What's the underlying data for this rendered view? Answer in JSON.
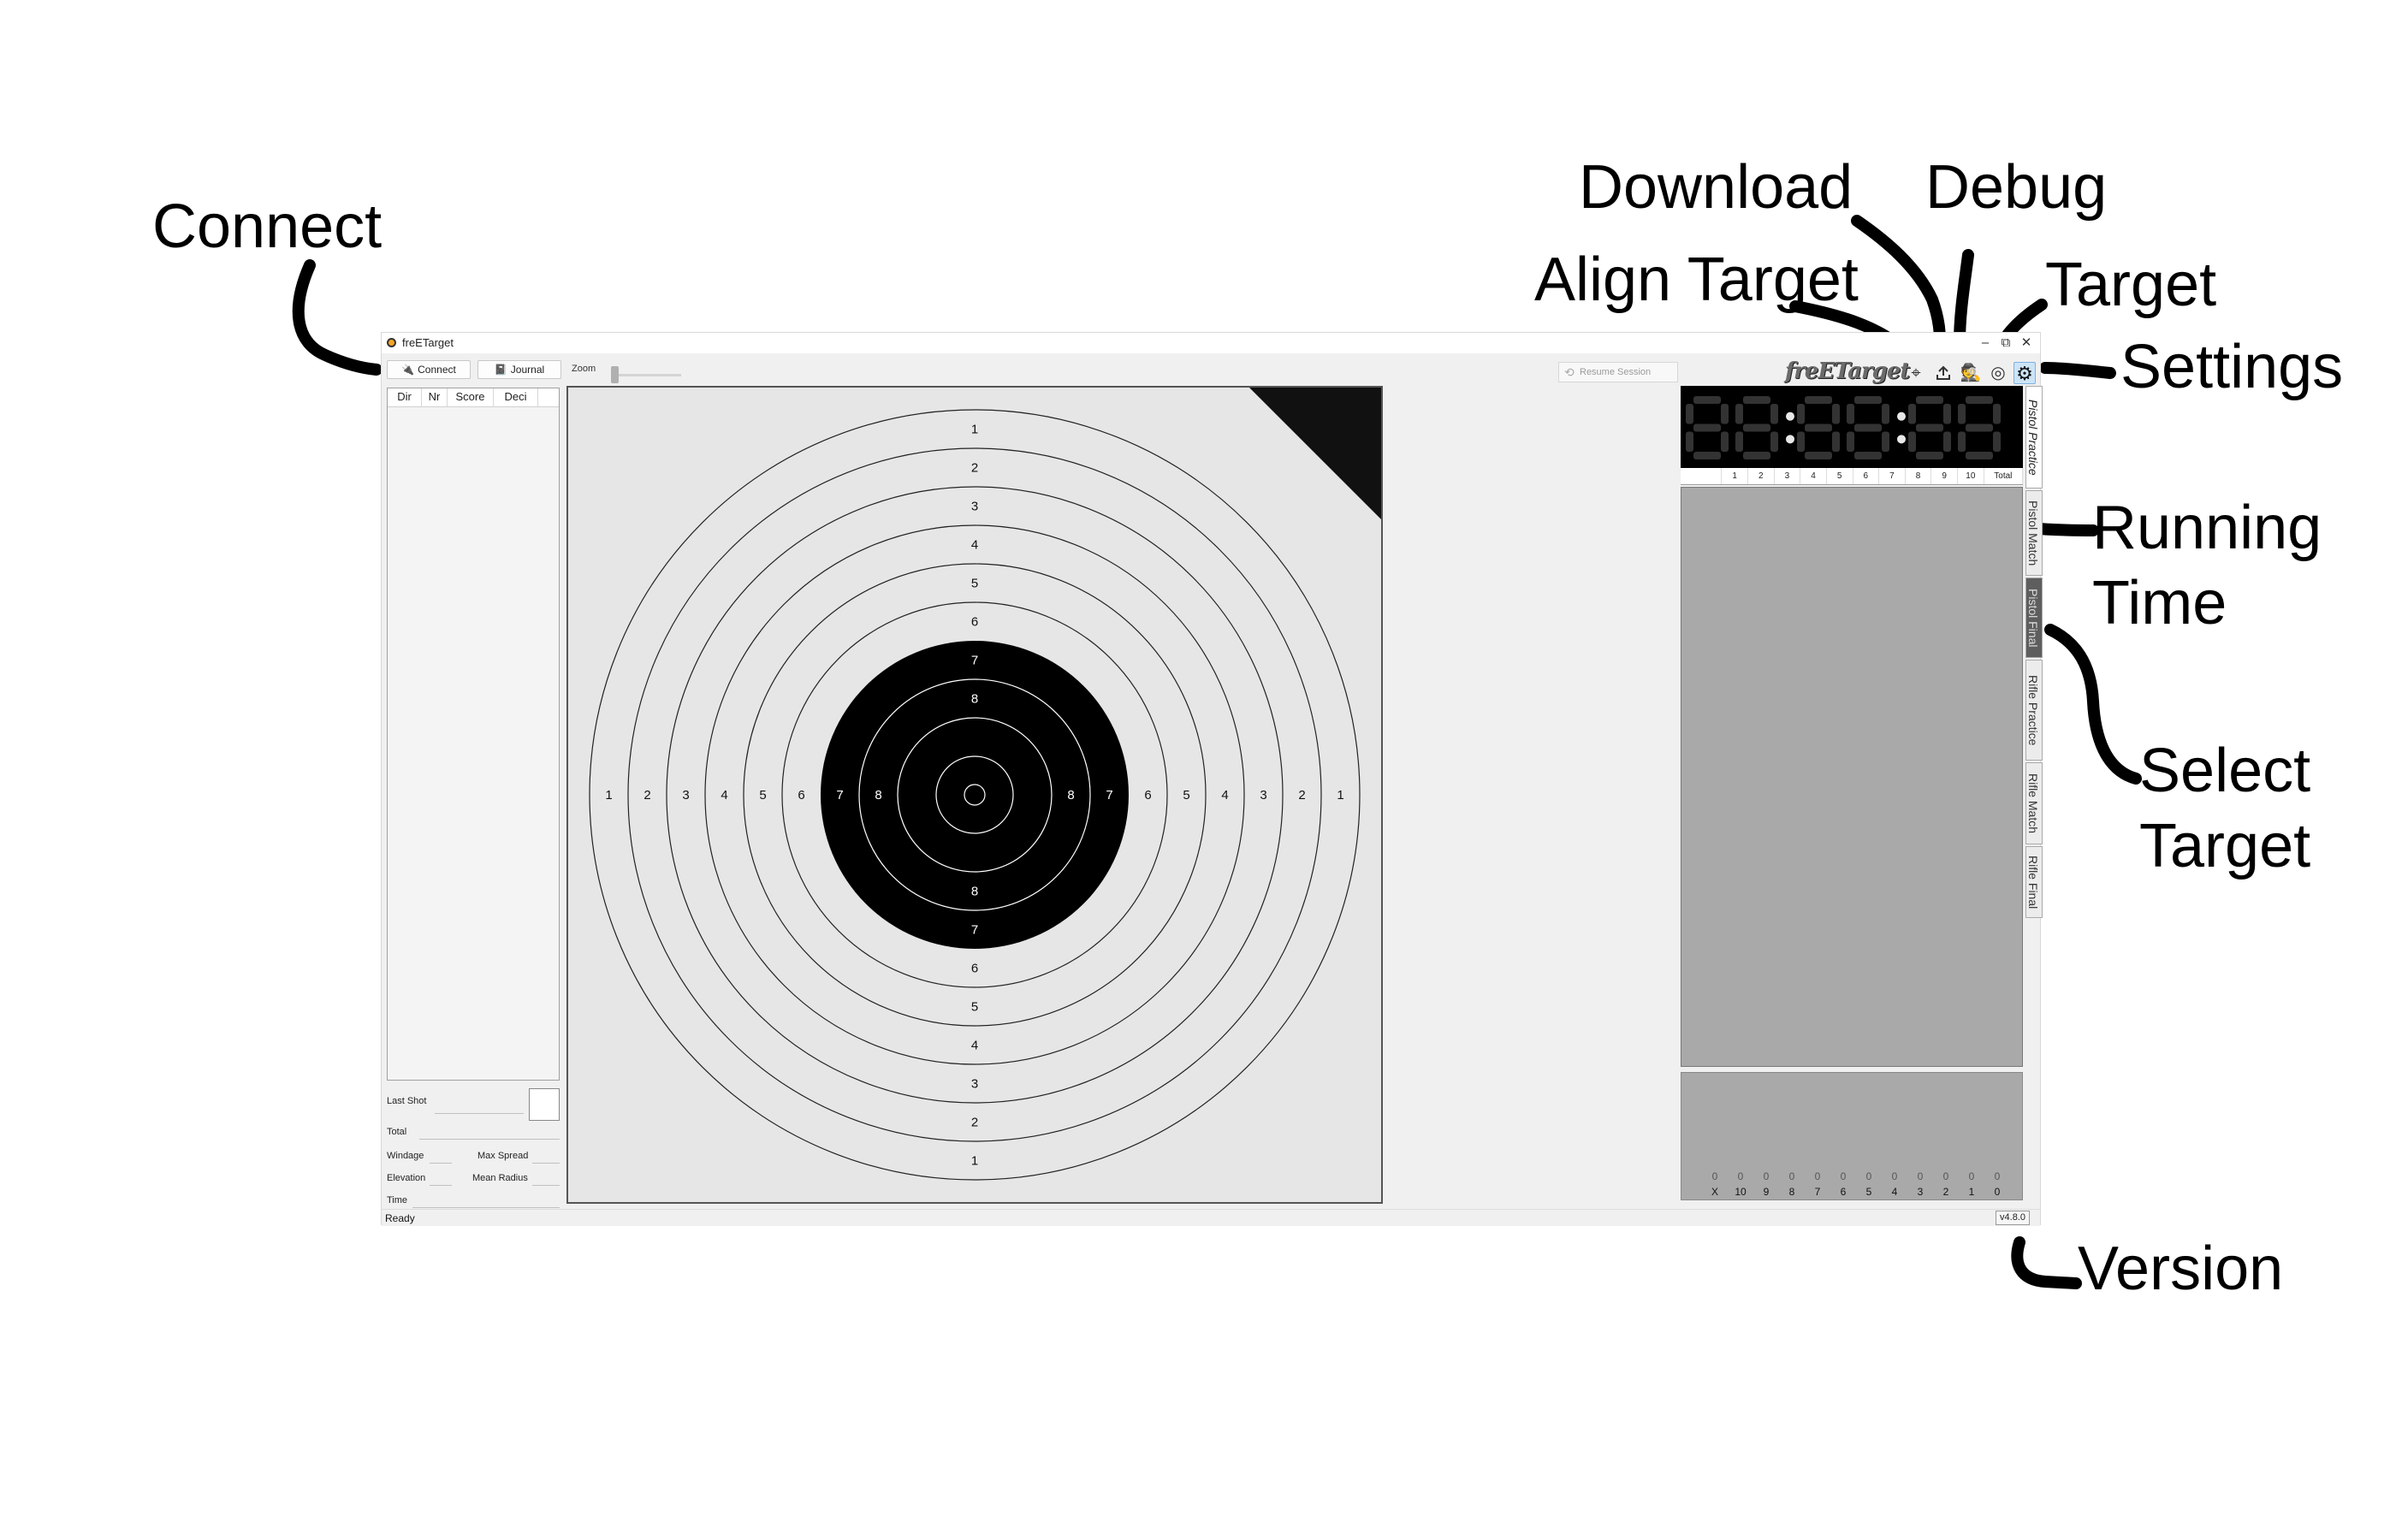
{
  "callouts": {
    "connect": "Connect",
    "download": "Download",
    "debug": "Debug",
    "align_target": "Align Target",
    "target": "Target",
    "settings": "Settings",
    "running_time_1": "Running",
    "running_time_2": "Time",
    "select_target_1": "Select",
    "select_target_2": "Target",
    "version": "Version"
  },
  "window": {
    "title": "freETarget",
    "controls": {
      "minimize": "–",
      "restore": "⧉",
      "close": "✕"
    }
  },
  "toolbar": {
    "connect_label": "Connect",
    "connect_icon": "plug-icon",
    "journal_label": "Journal",
    "journal_icon": "book-icon",
    "zoom_label": "Zoom",
    "resume_label": "Resume Session",
    "logo_text": "freETarget",
    "icons": [
      "align-target-icon",
      "download-icon",
      "debug-icon",
      "target-icon",
      "settings-icon"
    ]
  },
  "shot_table": {
    "columns": [
      "Dir",
      "Nr",
      "Score",
      "Deci"
    ]
  },
  "stats": {
    "last_shot": "Last Shot",
    "total": "Total",
    "windage": "Windage",
    "max_spread": "Max Spread",
    "elevation": "Elevation",
    "mean_radius": "Mean Radius",
    "time": "Time"
  },
  "target": {
    "ring_numbers": [
      "1",
      "2",
      "3",
      "4",
      "5",
      "6",
      "7",
      "8"
    ],
    "black_from_ring": 7,
    "ring_color_light": "#e6e6e6",
    "ring_color_dark": "#000000"
  },
  "clock": {
    "digits": "88:88:88",
    "color_on": "#333333",
    "color_bg": "#000000"
  },
  "score_table": {
    "columns": [
      "",
      "1",
      "2",
      "3",
      "4",
      "5",
      "6",
      "7",
      "8",
      "9",
      "10",
      "Total"
    ]
  },
  "histogram": {
    "counts": [
      "0",
      "0",
      "0",
      "0",
      "0",
      "0",
      "0",
      "0",
      "0",
      "0",
      "0",
      "0"
    ],
    "labels": [
      "X",
      "10",
      "9",
      "8",
      "7",
      "6",
      "5",
      "4",
      "3",
      "2",
      "1",
      "0"
    ]
  },
  "target_tabs": [
    "Pistol Practice",
    "Pistol Match",
    "Pistol Final",
    "Rifle Practice",
    "Rifle Match",
    "Rifle Final"
  ],
  "status": {
    "text": "Ready",
    "version": "v4.8.0"
  }
}
